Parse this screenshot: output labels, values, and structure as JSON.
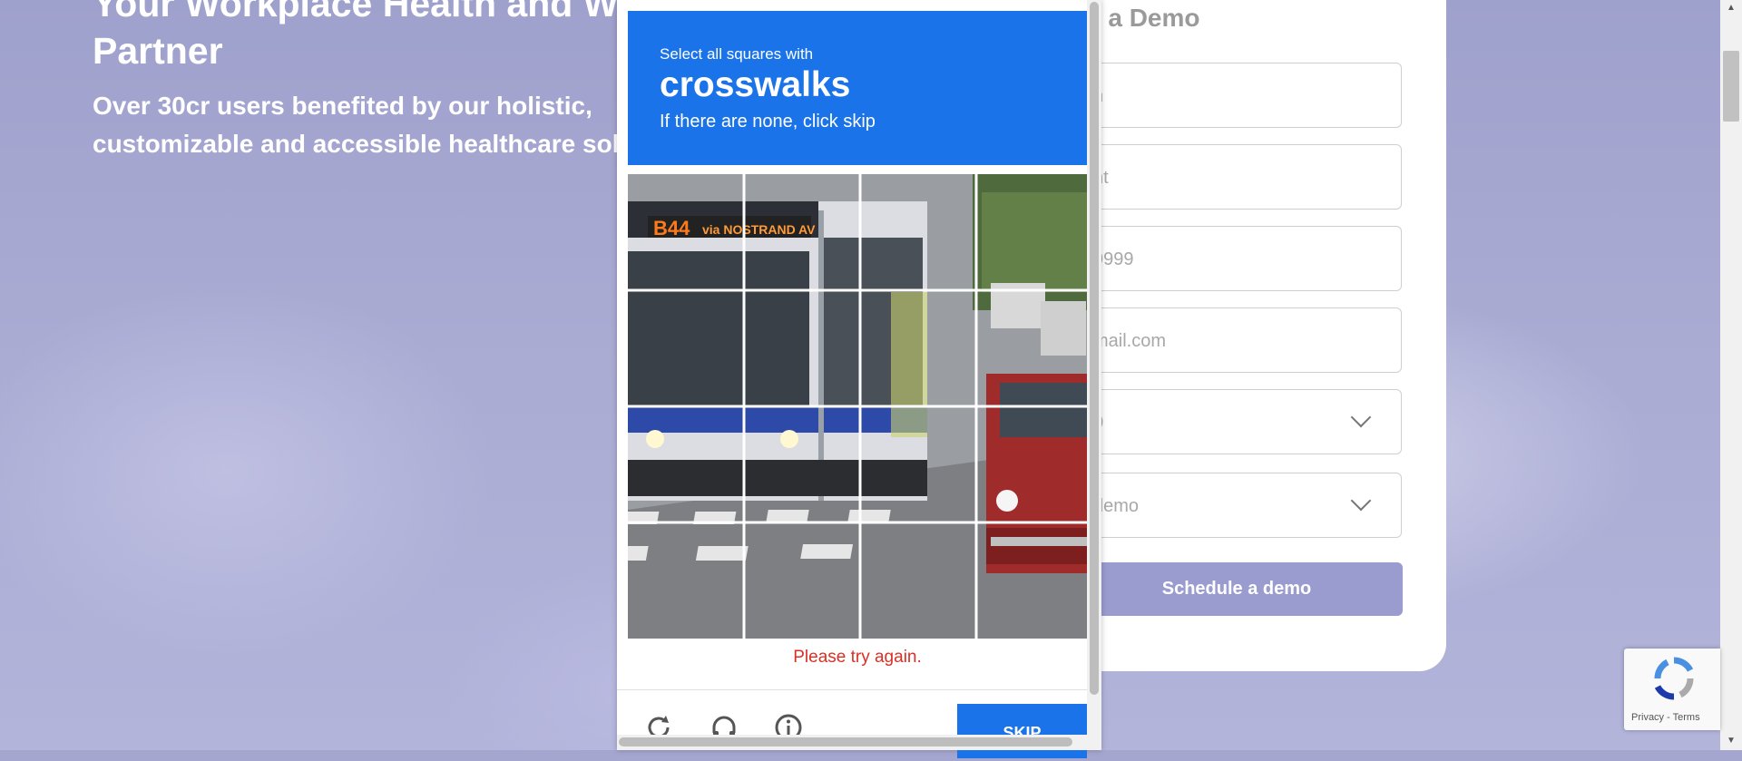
{
  "hero": {
    "title_line1": "Your Workplace Health and We",
    "title_line2": "Partner",
    "subtitle_line1": "Over 30cr users benefited by our holistic,",
    "subtitle_line2": "customizable and accessible healthcare solu"
  },
  "form": {
    "title": "e a Demo",
    "fields": [
      {
        "placeholder": "n"
      },
      {
        "placeholder": "nt"
      },
      {
        "placeholder": "9999"
      },
      {
        "placeholder": "mail.com"
      },
      {
        "placeholder": "0"
      },
      {
        "placeholder": "demo"
      }
    ],
    "submit_label": "Schedule a demo"
  },
  "captcha": {
    "instruction_small": "Select all squares with",
    "target": "crosswalks",
    "hint": "If there are none, click skip",
    "error": "Please try again.",
    "skip_label": "SKIP",
    "bus_sign": "B44",
    "bus_route": "via NOSTRAND AV",
    "grid_rows": 4,
    "grid_cols": 4
  },
  "recaptcha_badge": {
    "links": "Privacy - Terms"
  },
  "colors": {
    "accent": "#1a73e8",
    "error": "#d93025",
    "submit": "#9a9cd0"
  }
}
